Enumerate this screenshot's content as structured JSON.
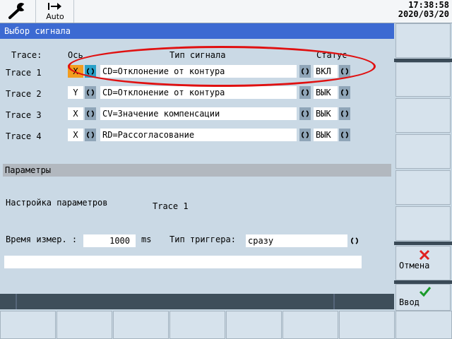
{
  "header": {
    "mode_label": "Auto",
    "time": "17:38:58",
    "date": "2020/03/20"
  },
  "window_title": "Выбор сигнала",
  "table": {
    "col_trace": "Trace:",
    "col_axis": "Ось",
    "col_signal": "Тип сигнала",
    "col_status": "Статус",
    "rows": [
      {
        "label": "Trace 1",
        "axis": "X",
        "signal": "CD=Отклонение от контура",
        "status": "ВКЛ"
      },
      {
        "label": "Trace 2",
        "axis": "Y",
        "signal": "CD=Отклонение от контура",
        "status": "ВЫК"
      },
      {
        "label": "Trace 3",
        "axis": "X",
        "signal": "CV=Значение компенсации",
        "status": "ВЫК"
      },
      {
        "label": "Trace 4",
        "axis": "X",
        "signal": "RD=Рассогласование",
        "status": "ВЫК"
      }
    ]
  },
  "params": {
    "section_title": "Параметры",
    "setup_label": "Настройка параметров",
    "setup_value": "Trace 1",
    "meas_time_label": "Время измер. :",
    "meas_time_value": "1000",
    "meas_time_unit": "ms",
    "trigger_label": "Тип триггера:",
    "trigger_value": "сразу"
  },
  "softkeys": {
    "cancel_label": "Отмена",
    "ok_label": "Ввод"
  },
  "colors": {
    "title_bar": "#3c6ad2",
    "selection": "#f39c1e",
    "toggle_selected": "#2aa0c8",
    "cancel_icon": "#e02020",
    "ok_icon": "#1a9a2a",
    "annotation": "#e01010"
  }
}
